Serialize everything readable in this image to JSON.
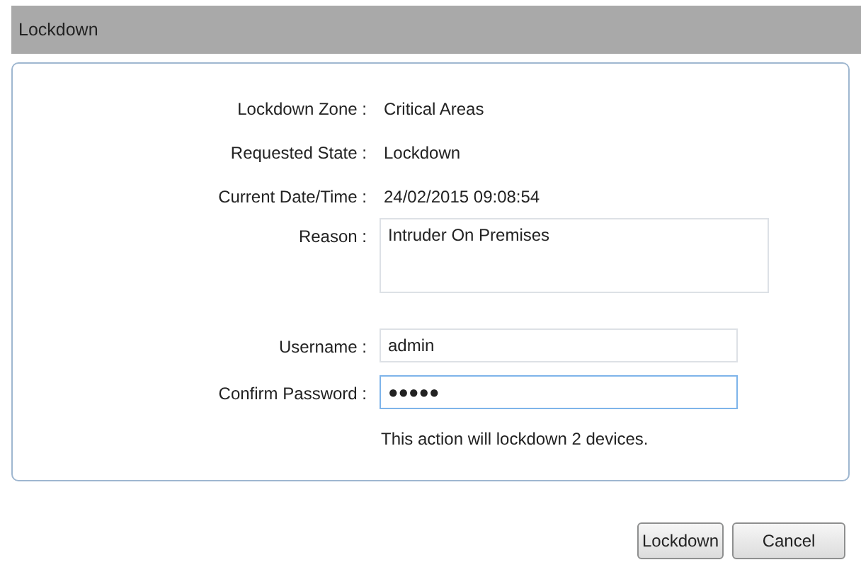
{
  "window": {
    "title": "Lockdown"
  },
  "fields": [
    {
      "kind": "text",
      "label": "Lockdown Zone :",
      "value": "Critical Areas"
    },
    {
      "kind": "text",
      "label": "Requested State :",
      "value": "Lockdown"
    },
    {
      "kind": "text",
      "label": "Current Date/Time :",
      "value": "24/02/2015 09:08:54"
    },
    {
      "kind": "textarea",
      "label": "Reason :",
      "value": "Intruder On Premises",
      "focused": false
    },
    {
      "kind": "input",
      "label": "Username :",
      "value": "admin",
      "focused": false
    },
    {
      "kind": "input",
      "label": "Confirm Password :",
      "value": "●●●●●",
      "focused": true
    }
  ],
  "message": "This action will lockdown 2 devices.",
  "buttons": [
    "Lockdown",
    "Cancel"
  ]
}
